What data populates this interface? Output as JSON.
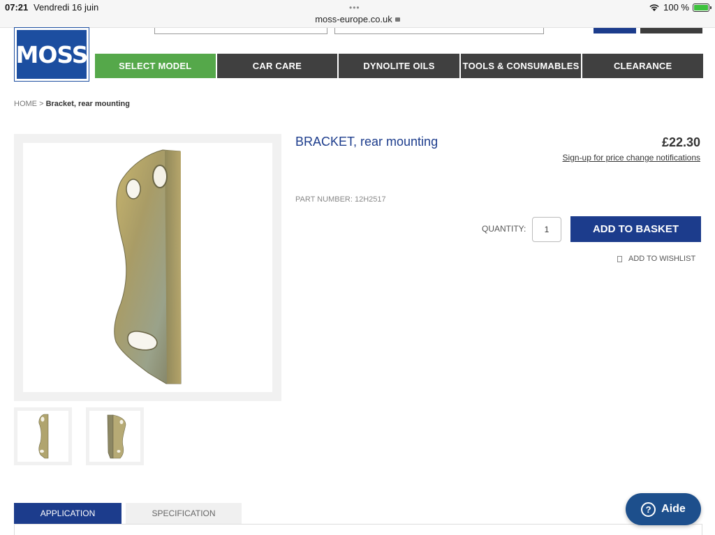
{
  "status_bar": {
    "time": "07:21",
    "date": "Vendredi 16 juin",
    "url": "moss-europe.co.uk",
    "battery": "100 %",
    "dots": "•••"
  },
  "logo": {
    "text": "MOSS",
    "color": "#1c4ea0"
  },
  "nav": [
    {
      "label": "SELECT MODEL",
      "active": true
    },
    {
      "label": "CAR CARE"
    },
    {
      "label": "DYNOLITE OILS"
    },
    {
      "label": "TOOLS & CONSUMABLES"
    },
    {
      "label": "CLEARANCE"
    }
  ],
  "breadcrumb": {
    "home": "HOME",
    "separator": ">",
    "current": "Bracket, rear mounting"
  },
  "product": {
    "title": "BRACKET, rear mounting",
    "price": "£22.30",
    "price_notify": "Sign-up for price change notifications",
    "part_number": "PART NUMBER: 12H2517",
    "quantity_label": "QUANTITY:",
    "quantity": "1",
    "add_to_basket": "ADD TO BASKET",
    "wishlist": "ADD TO WISHLIST"
  },
  "tabs": [
    {
      "label": "APPLICATION",
      "active": true
    },
    {
      "label": "SPECIFICATION"
    }
  ],
  "help": {
    "label": "Aide"
  },
  "colors": {
    "brand_blue": "#1c3c8c",
    "nav_active": "#55a84a",
    "nav_dark": "#404040"
  }
}
